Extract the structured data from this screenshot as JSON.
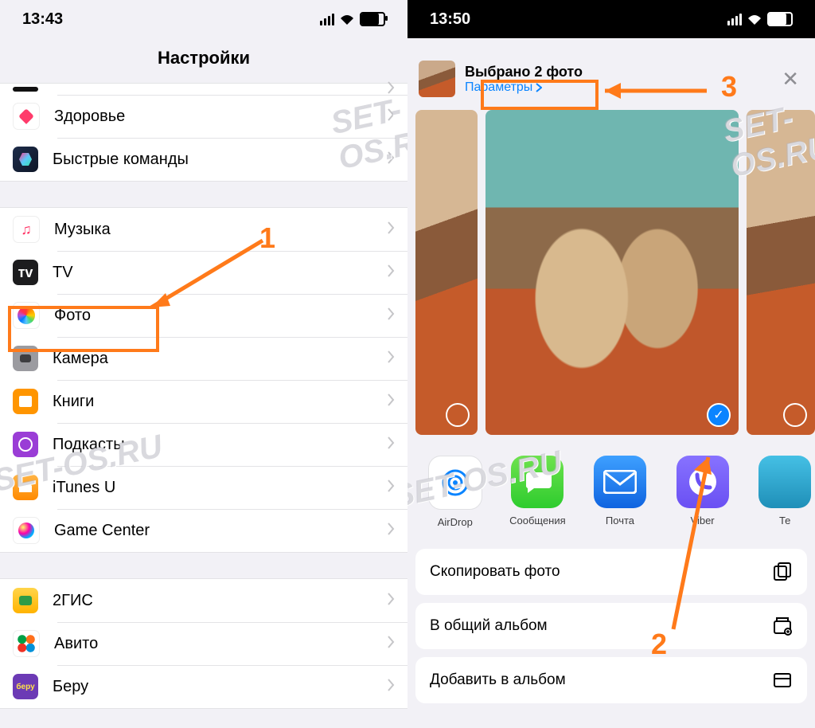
{
  "left": {
    "time": "13:43",
    "title": "Настройки",
    "groups": [
      [
        {
          "icon": "ic-empty",
          "label": ""
        },
        {
          "icon": "ic-health",
          "label": "Здоровье"
        },
        {
          "icon": "ic-shortcuts",
          "label": "Быстрые команды"
        }
      ],
      [
        {
          "icon": "ic-music",
          "label": "Музыка"
        },
        {
          "icon": "ic-tv",
          "label": "TV",
          "iconText": "ᴛᴠ"
        },
        {
          "icon": "ic-photos",
          "label": "Фото"
        },
        {
          "icon": "ic-camera",
          "label": "Камера"
        },
        {
          "icon": "ic-books",
          "label": "Книги"
        },
        {
          "icon": "ic-podcasts",
          "label": "Подкасты"
        },
        {
          "icon": "ic-itunesu",
          "label": "iTunes U"
        },
        {
          "icon": "ic-gamecenter",
          "label": "Game Center"
        }
      ],
      [
        {
          "icon": "ic-2gis",
          "label": "2ГИС"
        },
        {
          "icon": "ic-avito",
          "label": "Авито"
        },
        {
          "icon": "ic-beru",
          "label": "Беру"
        }
      ]
    ],
    "annotations": {
      "one": "1"
    }
  },
  "right": {
    "time": "13:50",
    "selectedTitle": "Выбрано 2 фото",
    "optionsLabel": "Параметры",
    "apps": [
      {
        "cls": "b-airdrop",
        "name": "AirDrop"
      },
      {
        "cls": "b-msg",
        "name": "Сообщения"
      },
      {
        "cls": "b-mail",
        "name": "Почта"
      },
      {
        "cls": "b-viber",
        "name": "Viber"
      },
      {
        "cls": "b-edge",
        "name": "Те"
      }
    ],
    "actions": [
      "Скопировать фото",
      "В общий альбом",
      "Добавить в альбом"
    ],
    "annotations": {
      "two": "2",
      "three": "3"
    }
  },
  "watermark": "SET-OS.RU"
}
